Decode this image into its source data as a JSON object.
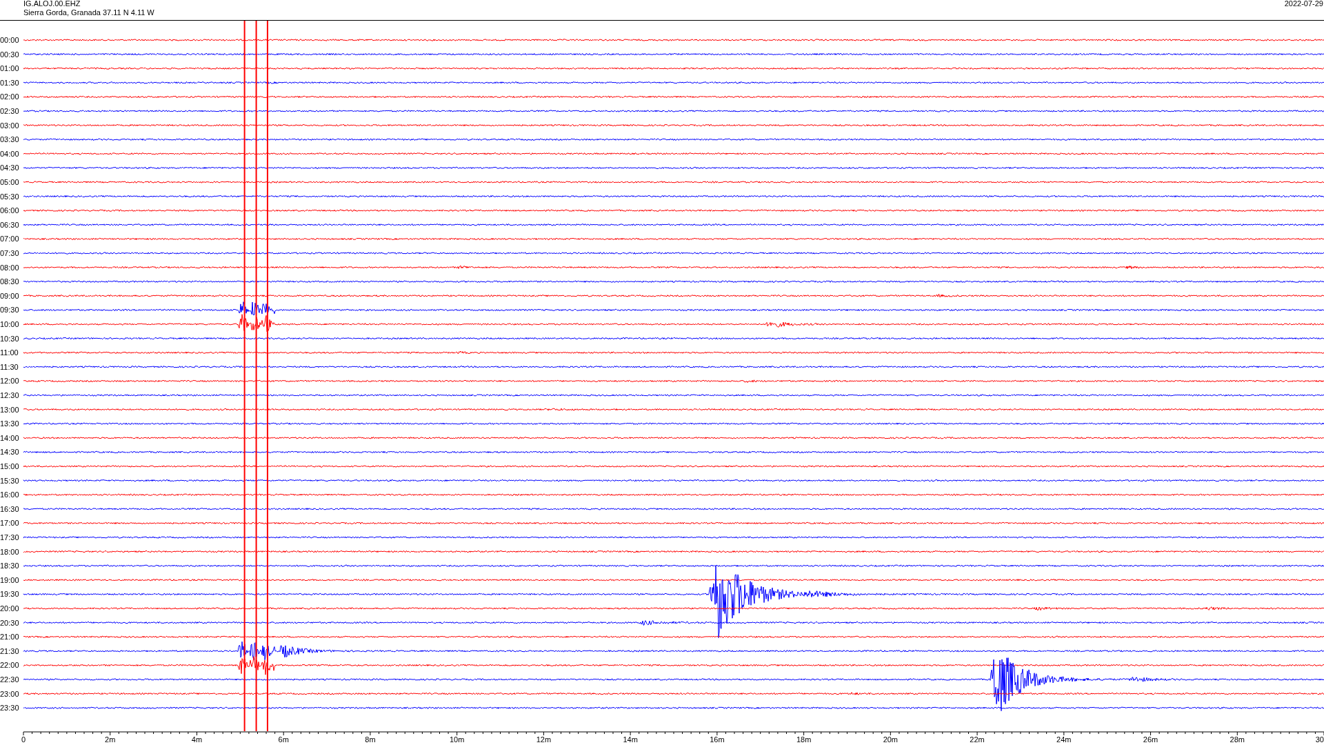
{
  "header": {
    "station": "IG.ALOJ.00.EHZ",
    "location": "Sierra Gorda, Granada  37.11 N 4.11 W",
    "date": "2022-07-29"
  },
  "traces": [
    {
      "label": "00:00",
      "color": "#ff0000"
    },
    {
      "label": "00:30",
      "color": "#0000ff"
    },
    {
      "label": "01:00",
      "color": "#ff0000"
    },
    {
      "label": "01:30",
      "color": "#0000ff"
    },
    {
      "label": "02:00",
      "color": "#ff0000"
    },
    {
      "label": "02:30",
      "color": "#0000ff"
    },
    {
      "label": "03:00",
      "color": "#ff0000"
    },
    {
      "label": "03:30",
      "color": "#0000ff"
    },
    {
      "label": "04:00",
      "color": "#ff0000"
    },
    {
      "label": "04:30",
      "color": "#0000ff"
    },
    {
      "label": "05:00",
      "color": "#ff0000"
    },
    {
      "label": "05:30",
      "color": "#0000ff"
    },
    {
      "label": "06:00",
      "color": "#ff0000"
    },
    {
      "label": "06:30",
      "color": "#0000ff"
    },
    {
      "label": "07:00",
      "color": "#ff0000"
    },
    {
      "label": "07:30",
      "color": "#0000ff"
    },
    {
      "label": "08:00",
      "color": "#ff0000"
    },
    {
      "label": "08:30",
      "color": "#0000ff"
    },
    {
      "label": "09:00",
      "color": "#ff0000"
    },
    {
      "label": "09:30",
      "color": "#0000ff"
    },
    {
      "label": "10:00",
      "color": "#ff0000"
    },
    {
      "label": "10:30",
      "color": "#0000ff"
    },
    {
      "label": "11:00",
      "color": "#ff0000"
    },
    {
      "label": "11:30",
      "color": "#0000ff"
    },
    {
      "label": "12:00",
      "color": "#ff0000"
    },
    {
      "label": "12:30",
      "color": "#0000ff"
    },
    {
      "label": "13:00",
      "color": "#ff0000"
    },
    {
      "label": "13:30",
      "color": "#0000ff"
    },
    {
      "label": "14:00",
      "color": "#ff0000"
    },
    {
      "label": "14:30",
      "color": "#0000ff"
    },
    {
      "label": "15:00",
      "color": "#ff0000"
    },
    {
      "label": "15:30",
      "color": "#0000ff"
    },
    {
      "label": "16:00",
      "color": "#ff0000"
    },
    {
      "label": "16:30",
      "color": "#0000ff"
    },
    {
      "label": "17:00",
      "color": "#ff0000"
    },
    {
      "label": "17:30",
      "color": "#0000ff"
    },
    {
      "label": "18:00",
      "color": "#ff0000"
    },
    {
      "label": "18:30",
      "color": "#0000ff"
    },
    {
      "label": "19:00",
      "color": "#ff0000"
    },
    {
      "label": "19:30",
      "color": "#0000ff"
    },
    {
      "label": "20:00",
      "color": "#ff0000"
    },
    {
      "label": "20:30",
      "color": "#0000ff"
    },
    {
      "label": "21:00",
      "color": "#ff0000"
    },
    {
      "label": "21:30",
      "color": "#0000ff"
    },
    {
      "label": "22:00",
      "color": "#ff0000"
    },
    {
      "label": "22:30",
      "color": "#0000ff"
    },
    {
      "label": "23:00",
      "color": "#ff0000"
    },
    {
      "label": "23:30",
      "color": "#0000ff"
    }
  ],
  "x_axis": {
    "labels": [
      "0",
      "2m",
      "4m",
      "6m",
      "8m",
      "10m",
      "12m",
      "14m",
      "16m",
      "18m",
      "20m",
      "22m",
      "24m",
      "26m",
      "28m",
      "30"
    ]
  }
}
